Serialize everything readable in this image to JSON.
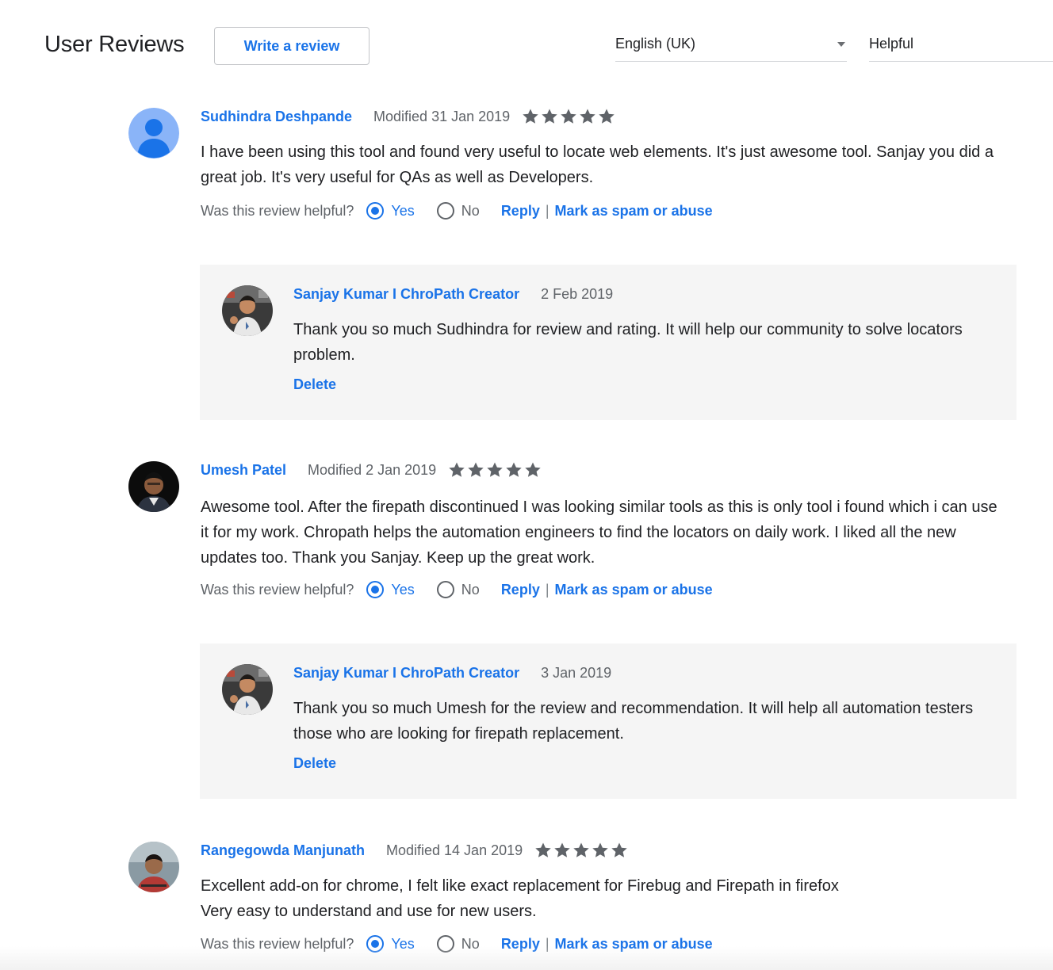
{
  "header": {
    "title": "User Reviews",
    "write_review_label": "Write a review",
    "language_selected": "English (UK)",
    "sort_selected": "Helpful"
  },
  "labels": {
    "helpful_question": "Was this review helpful?",
    "yes": "Yes",
    "no": "No",
    "reply": "Reply",
    "separator": "|",
    "spam": "Mark as spam or abuse",
    "delete": "Delete"
  },
  "colors": {
    "link": "#1a73e8",
    "star": "#5f6368",
    "reply_background": "#f5f5f5",
    "avatar_placeholder": "#8ab4f8"
  },
  "reviews": [
    {
      "author": "Sudhindra Deshpande",
      "date": "Modified 31 Jan 2019",
      "rating": 5,
      "text": "I have been using this tool  and found very useful to locate web elements. It's just awesome tool. Sanjay you did a great job. It's very useful for QAs as well as Developers.",
      "helpful_selected": "Yes",
      "reply": {
        "author": "Sanjay Kumar I ChroPath Creator",
        "date": "2 Feb 2019",
        "text": "Thank you so much Sudhindra for review and rating. It will help our community to solve locators problem."
      }
    },
    {
      "author": "Umesh Patel",
      "date": "Modified 2 Jan 2019",
      "rating": 5,
      "text": "Awesome tool. After the firepath discontinued I was looking similar tools as this is only tool i found which i can use it for my work. Chropath helps the automation engineers to find the locators on daily work. I liked all the new updates too. Thank you Sanjay. Keep up the great work.",
      "helpful_selected": "Yes",
      "reply": {
        "author": "Sanjay Kumar I ChroPath Creator",
        "date": "3 Jan 2019",
        "text": "Thank you so much Umesh for the review and recommendation. It will help all automation testers those who are looking for firepath replacement."
      }
    },
    {
      "author": "Rangegowda Manjunath",
      "date": "Modified 14 Jan 2019",
      "rating": 5,
      "text_lines": [
        "Excellent add-on for chrome, I felt like exact replacement for Firebug and Firepath in firefox",
        "Very easy to understand and use for new users."
      ],
      "helpful_selected": "Yes"
    }
  ]
}
